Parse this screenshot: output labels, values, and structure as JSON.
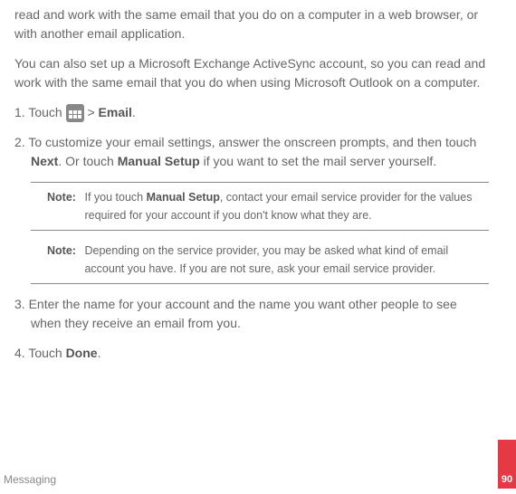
{
  "intro": {
    "p1": "read and work with the same email that you do on a computer in a web browser, or with another email application.",
    "p2": "You can also set up a Microsoft Exchange ActiveSync account, so you can read and work with the same email that you do when using Microsoft Outlook on a computer."
  },
  "steps": {
    "s1_prefix": "1. Touch ",
    "s1_gt": " > ",
    "s1_email": "Email",
    "s1_period": ".",
    "s2_a": "2. To customize your email settings, answer the onscreen prompts, and then touch ",
    "s2_next": "Next",
    "s2_b": ". Or touch ",
    "s2_manual": "Manual Setup",
    "s2_c": " if you want to set the mail server yourself.",
    "s3": "3. Enter the name for your account and the name you want other people to see when they receive an email from you.",
    "s4_a": "4. Touch ",
    "s4_done": "Done",
    "s4_b": "."
  },
  "notes": {
    "label": "Note:",
    "n1_a": "If you touch ",
    "n1_manual": "Manual Setup",
    "n1_b": ", contact your email service provider for the values required for your account if you don't know what they are.",
    "n2": "Depending on the service provider, you may be asked what kind of email account you have. If you are not sure, ask your email service provider."
  },
  "footer": {
    "section": "Messaging",
    "page": "90"
  }
}
